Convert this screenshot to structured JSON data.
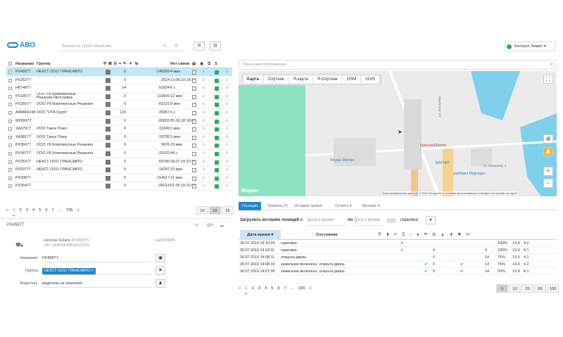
{
  "app": {
    "logo": "АВО",
    "filter_placeholder": "Фильтр по 11019 объектам",
    "user": "Контрол Лизинг"
  },
  "left_table": {
    "headers": {
      "name": "Название",
      "group": "Группа",
      "no_link": "Нет связи"
    },
    "rows": [
      {
        "name": "РХ45877",
        "group": "НЕКСТ ООО ТРАНСАВТО",
        "v": "0",
        "dist": "-148309",
        "nc": "4 мин",
        "sel": true,
        "two": false
      },
      {
        "name": "РХ35277",
        "group": "",
        "v": "0",
        "dist": "2014",
        "nc": "13.06.19 18:32",
        "two": false
      },
      {
        "name": "НК74877",
        "group": "",
        "v": "14",
        "dist": "-51824",
        "nc": "6 с",
        "two": false
      },
      {
        "name": "РХ33577",
        "group": "ООО УК Комплексные Решения,Ярославль",
        "v": "0",
        "dist": "-119609",
        "nc": "12 мин",
        "two": true
      },
      {
        "name": "РХ35077",
        "group": "ООО УК Комплексные Решения",
        "v": "0",
        "dist": "-83131",
        "nc": "8 мин",
        "two": false
      },
      {
        "name": "А488КА198",
        "group": "ООО \"НТА-Групп\"",
        "v": "123",
        "dist": "-35957",
        "nc": "6 с",
        "two": false
      },
      {
        "name": "М269977",
        "group": "",
        "v": "0",
        "dist": "-86833",
        "nc": "05.09.18 18:09",
        "two": false
      },
      {
        "name": "ХА37977",
        "group": "ООО Такси Плюс",
        "v": "0",
        "dist": "-11849",
        "nc": "2 мин",
        "two": false
      },
      {
        "name": "ХА38177",
        "group": "ООО Такси Плюс",
        "v": "0",
        "dist": "-18795",
        "nc": "3 мин",
        "two": false
      },
      {
        "name": "РХ36077",
        "group": "ООО УК Комплексные Решения",
        "v": "0",
        "dist": "9976",
        "nc": "29 мин",
        "two": false
      },
      {
        "name": "РХ34777",
        "group": "ООО УК Комплексные Решения",
        "v": "0",
        "dist": "-25102",
        "nc": "44 с",
        "two": false
      },
      {
        "name": "РХ35377",
        "group": "НЕКСТ ООО ТРАНСАВТО",
        "v": "0",
        "dist": "-69780",
        "nc": "28.07.19 22:38",
        "two": false
      },
      {
        "name": "РХ33777",
        "group": "НЕКСТ ООО ТРАНСАВТО",
        "v": "0",
        "dist": "-18297",
        "nc": "23 мин",
        "two": false
      },
      {
        "name": "РХ33877",
        "group": "",
        "v": "0",
        "dist": "-114617",
        "nc": "21 мин",
        "two": false
      },
      {
        "name": "РХ35477",
        "group": "",
        "v": "0",
        "dist": "-95014",
        "nc": "01.05.19 10:48",
        "two": false
      }
    ],
    "pager": [
      "«",
      "1",
      "2",
      "3",
      "4",
      "5",
      "6",
      "7",
      "...",
      "735",
      "»"
    ],
    "sizes": [
      "10",
      "15",
      "25"
    ]
  },
  "details": {
    "title": "РХ45877",
    "tab_gps": "gps",
    "car_model": "Hyundai Solaris",
    "car_plate": "(РХ45877)",
    "car_vin": "VIN: Z94K241BBJR022761",
    "pal": "pal0970885",
    "name_label": "Название:",
    "name_value": "РХ45877",
    "group_label": "Группа:",
    "group_value": "НЕКСТ ООО ТРАНСАВТО",
    "driver_label": "Водитель:",
    "driver_value": "водитель не назначен"
  },
  "map": {
    "search_placeholder": "Поиск местоположения...",
    "tabs": [
      "Карта",
      "Спутник",
      "Я.карта",
      "Я.Спутник",
      "OSM",
      "2GIS"
    ],
    "labels": [
      "Яндекс",
      "ул. Бахарева",
      "Красное&Белое",
      "МАГНИТ",
      "Якудза Моторс",
      "разборка Мерседес",
      "ул. Бахарева, 4"
    ],
    "footer": "Картографические данные © 2019 Google   50 м   Условия использования   Сообщить об ошибке на карте"
  },
  "right_tabs": {
    "items": [
      "Позиция",
      "Тревоги (2)",
      "История тревог",
      "Отчеты ▾",
      "Экспорт ▾"
    ]
  },
  "history": {
    "label": "Загрузить историю позиций с",
    "from_ph": "Дата и время",
    "po": "по",
    "to_ph": "Дата и время",
    "parking": "парковки"
  },
  "pos_table": {
    "headers": {
      "date": "Дата время ▾",
      "state": "Состояние"
    },
    "rows": [
      {
        "date": "30.07.2019 14:19:25",
        "state": "парковка",
        "a": "",
        "b": "",
        "c": "",
        "d": "",
        "e": "100%",
        "f": "13.4",
        "g": "4.2"
      },
      {
        "date": "30.07.2019 14:19:11",
        "state": "парковка",
        "a": "0",
        "b": "",
        "c": "0",
        "d": "",
        "e": "100%",
        "f": "13.4",
        "g": "4.1"
      },
      {
        "date": "30.07.2019 14:08:11",
        "state": "открыта дверь",
        "a": "0",
        "b": "",
        "c": "14",
        "d": "",
        "e": "75%",
        "f": "13.5",
        "g": "4.1"
      },
      {
        "date": "30.07.2019 14:08:10",
        "state": "зажигание включено, открыта дверь",
        "a": "0",
        "b": "",
        "c": "14",
        "d": "",
        "e": "75%",
        "f": "14.4",
        "g": "4.2"
      },
      {
        "date": "30.07.2019 14:07:36",
        "state": "зажигание включено, открыта дверь",
        "a": "0",
        "b": "",
        "c": "14",
        "d": "",
        "e": "50%",
        "f": "13.4",
        "g": "4.1"
      }
    ],
    "pager": [
      "«",
      "1",
      "2",
      "3",
      "4",
      "5",
      "6",
      "7",
      "...",
      "100",
      "»"
    ],
    "sizes": [
      "5",
      "10",
      "25",
      "50",
      "100"
    ]
  }
}
